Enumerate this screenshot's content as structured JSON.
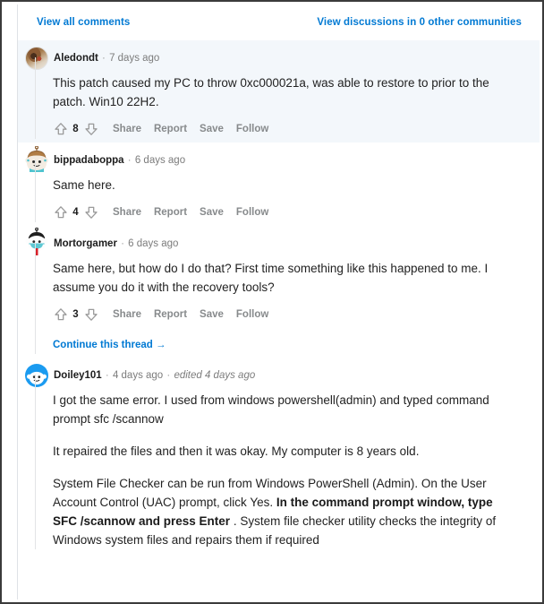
{
  "header": {
    "view_all_comments": "View all comments",
    "view_other_communities": "View discussions in 0 other communities"
  },
  "colors": {
    "link_blue": "#0079d3",
    "highlight_bg": "#f3f7fb",
    "action_grey": "#878a8c",
    "text": "#222222",
    "thread_line": "#e2e4e6"
  },
  "actions": {
    "share": "Share",
    "report": "Report",
    "save": "Save",
    "follow": "Follow",
    "upvote_icon": "upvote-arrow-icon",
    "downvote_icon": "downvote-arrow-icon"
  },
  "continue_thread": {
    "label": "Continue this thread",
    "arrow": "→"
  },
  "comments": [
    {
      "id": "c1",
      "author": "Aledondt",
      "timestamp": "7 days ago",
      "edited": "",
      "highlighted": true,
      "avatar_kind": "photo-avatar",
      "score": "8",
      "paragraphs": [
        "This patch caused my PC to throw 0xc000021a, was able to restore to prior to the patch. Win10 22H2."
      ]
    },
    {
      "id": "c2",
      "author": "bippadaboppa",
      "timestamp": "6 days ago",
      "edited": "",
      "highlighted": false,
      "avatar_kind": "snoo-brown-avatar",
      "score": "4",
      "paragraphs": [
        "Same here."
      ]
    },
    {
      "id": "c3",
      "author": "Mortorgamer",
      "timestamp": "6 days ago",
      "edited": "",
      "highlighted": false,
      "avatar_kind": "snoo-mask-avatar",
      "score": "3",
      "paragraphs": [
        "Same here, but how do I do that? First time something like this happened to me. I assume you do it with the recovery tools?"
      ],
      "has_continue_thread": true
    },
    {
      "id": "c4",
      "author": "Doiley101",
      "timestamp": "4 days ago",
      "edited": "edited 4 days ago",
      "highlighted": false,
      "avatar_kind": "snoo-blue-avatar",
      "score": "",
      "paragraphs": [
        "I got the same error. I used from windows powershell(admin) and typed command prompt sfc /scannow",
        "It repaired the files and then it was okay. My computer is 8 years old."
      ],
      "rich_paragraph": {
        "pre": "System File Checker can be run from Windows PowerShell (Admin). On the User Account Control (UAC) prompt, click Yes. ",
        "bold": "In the command prompt window, type SFC /scannow and press Enter",
        "post": " . System file checker utility checks the integrity of Windows system files and repairs them if required"
      }
    }
  ]
}
